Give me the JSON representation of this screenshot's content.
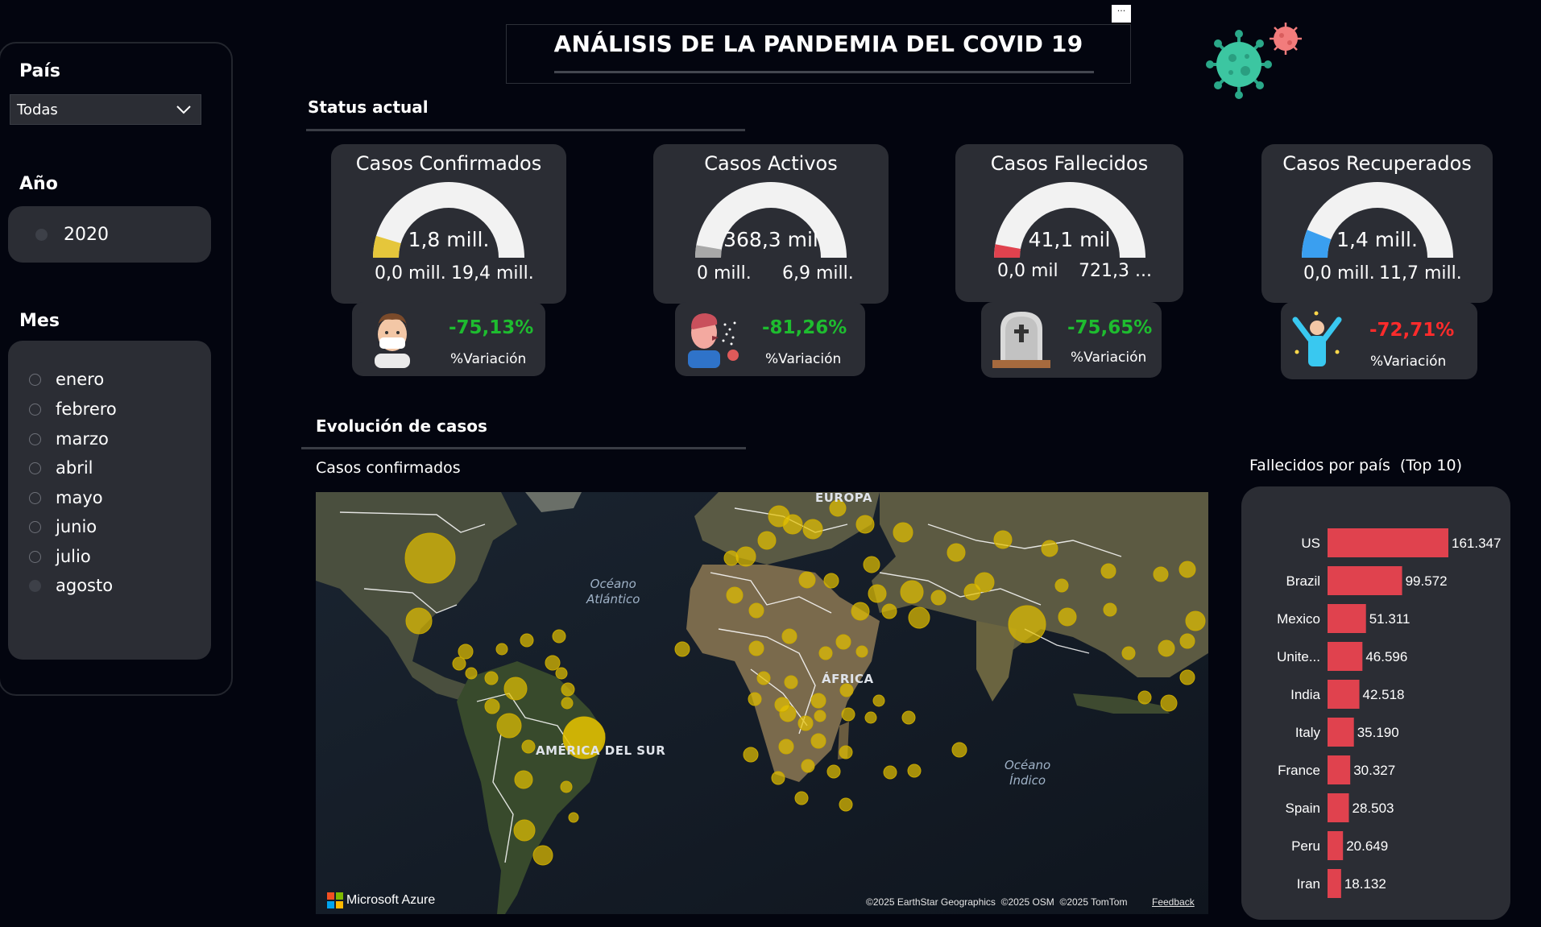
{
  "header": {
    "title": "ANÁLISIS DE LA PANDEMIA DEL COVID 19",
    "more_label": "···"
  },
  "slicers": {
    "pais": {
      "label": "País",
      "selected": "Todas"
    },
    "anio": {
      "label": "Año",
      "options": [
        "2020"
      ]
    },
    "mes": {
      "label": "Mes",
      "options": [
        "enero",
        "febrero",
        "marzo",
        "abril",
        "mayo",
        "junio",
        "julio",
        "agosto"
      ],
      "selected": "agosto"
    }
  },
  "status": {
    "title": "Status actual",
    "cards": [
      {
        "title": "Casos Confirmados",
        "value": "1,8 mill.",
        "min": "0,0 mill.",
        "max": "19,4 mill.",
        "fraction": 0.093,
        "fill_color": "#e5c63b",
        "variation": "-75,13%",
        "variation_label": "%Variación",
        "variation_positive": true
      },
      {
        "title": "Casos Activos",
        "value": "368,3 mil",
        "min": "0 mill.",
        "max": "6,9 mill.",
        "fraction": 0.053,
        "fill_color": "#a8a8a8",
        "variation": "-81,26%",
        "variation_label": "%Variación",
        "variation_positive": true
      },
      {
        "title": "Casos Fallecidos",
        "value": "41,1 mil",
        "min": "0,0 mil",
        "max": "721,3 ...",
        "fraction": 0.057,
        "fill_color": "#e0424e",
        "variation": "-75,65%",
        "variation_label": "%Variación",
        "variation_positive": true
      },
      {
        "title": "Casos Recuperados",
        "value": "1,4 mill.",
        "min": "0,0 mill.",
        "max": "11,7 mill.",
        "fraction": 0.12,
        "fill_color": "#3a9ff0",
        "variation": "-72,71%",
        "variation_label": "%Variación",
        "variation_positive": false
      }
    ]
  },
  "evolution": {
    "title": "Evolución de casos",
    "map_title": "Casos confirmados",
    "map_labels": {
      "atlantic": "Océano\nAtlántico",
      "indian": "Océano\nÍndico",
      "europe": "EUROPA",
      "africa": "ÁFRICA",
      "south_america": "AMÉRICA DEL SUR"
    },
    "attribution": "©2025 EarthStar Geographics  ©2025 OSM  ©2025 TomTom",
    "feedback": "Feedback",
    "brand": "Microsoft Azure"
  },
  "deaths_chart": {
    "title": "Fallecidos por país  (Top 10)"
  },
  "chart_data": {
    "type": "bar",
    "orientation": "horizontal",
    "title": "Fallecidos por país  (Top 10)",
    "categories": [
      "US",
      "Brazil",
      "Mexico",
      "Unite...",
      "India",
      "Italy",
      "France",
      "Spain",
      "Peru",
      "Iran"
    ],
    "values": [
      161347,
      99572,
      51311,
      46596,
      42518,
      35190,
      30327,
      28503,
      20649,
      18132
    ],
    "value_labels": [
      "161.347",
      "99.572",
      "51.311",
      "46.596",
      "42.518",
      "35.190",
      "30.327",
      "28.503",
      "20.649",
      "18.132"
    ],
    "bar_color": "#e0424e"
  },
  "colors": {
    "background": "#03050f",
    "card": "#2b2d34",
    "positive": "#1ebc2f",
    "negative": "#ff2b2b",
    "bubble": "#e5c200"
  }
}
